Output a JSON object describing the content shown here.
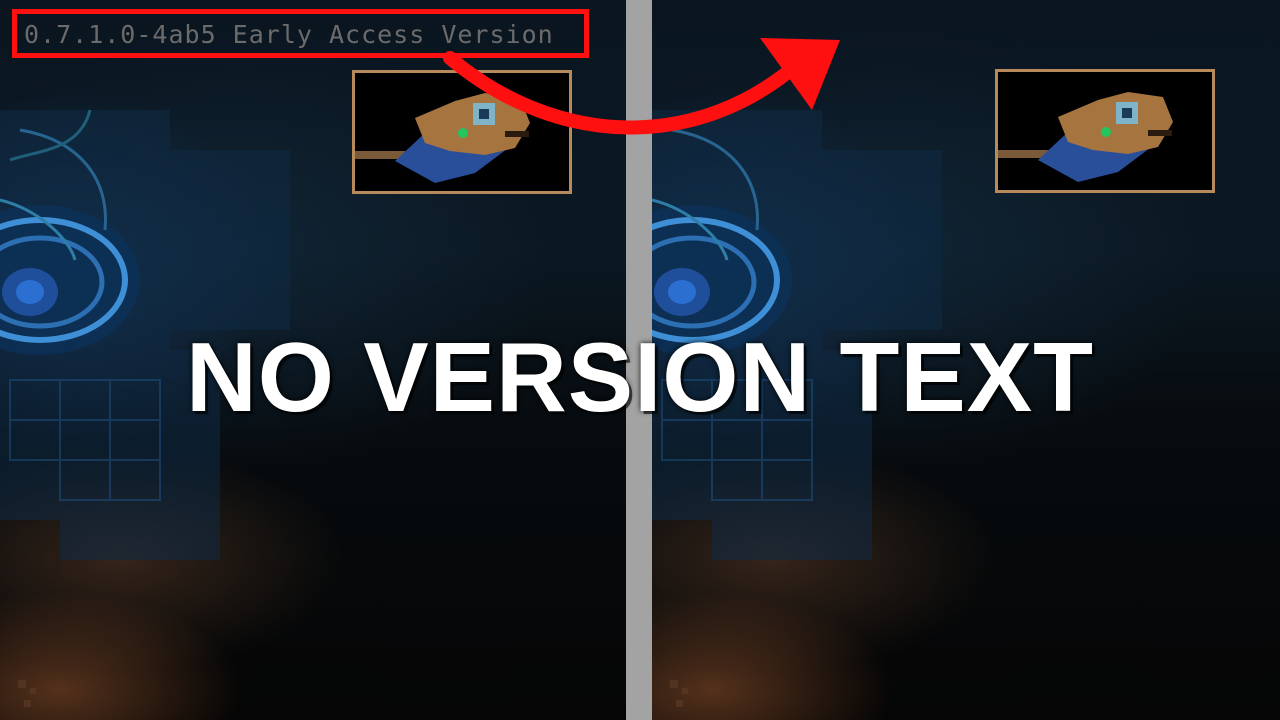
{
  "comparison": {
    "left": {
      "version_text": "0.7.1.0-4ab5 Early Access Version"
    },
    "right": {}
  },
  "headline": "NO VERSION TEXT",
  "colors": {
    "highlight": "#ff1010",
    "arrow": "#ff1010",
    "divider": "#a3a3a3",
    "frame_border": "#b8895a",
    "version_text": "#6b6b6b",
    "headline": "#ffffff"
  },
  "icons": {
    "portrait": "fish-creature-icon",
    "arrow": "curved-arrow-icon"
  }
}
